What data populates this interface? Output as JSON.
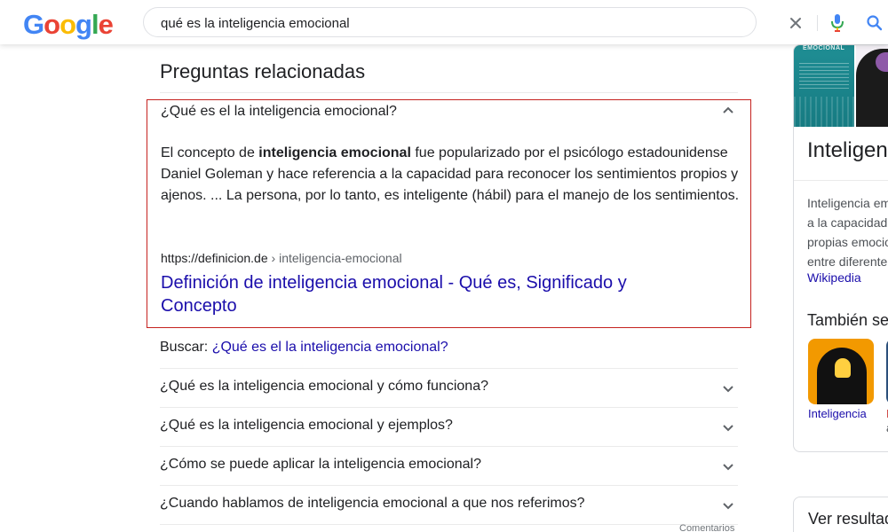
{
  "logo": {
    "letters": [
      "G",
      "o",
      "o",
      "g",
      "l",
      "e"
    ],
    "colors": [
      "#4285F4",
      "#EA4335",
      "#FBBC05",
      "#4285F4",
      "#34A853",
      "#EA4335"
    ]
  },
  "search": {
    "query": "qué es la inteligencia emocional"
  },
  "icons": {
    "clear": "close-icon",
    "mic": "microphone-icon",
    "search": "search-icon",
    "expand": "chevron-down-icon",
    "collapse": "chevron-up-icon"
  },
  "paa": {
    "title": "Preguntas relacionadas",
    "expanded": {
      "question": "¿Qué es el la inteligencia emocional?",
      "answer_prefix": "El concepto de ",
      "answer_bold": "inteligencia emocional",
      "answer_rest": " fue popularizado por el psicólogo estadounidense Daniel Goleman y hace referencia a la capacidad para reconocer los sentimientos propios y ajenos. ... La persona, por lo tanto, es inteligente (hábil) para el manejo de los sentimientos.",
      "source_url": "https://definicion.de",
      "source_crumb": " › inteligencia-emocional",
      "link_title": "Definición de inteligencia emocional - Qué es, Significado y Concepto"
    },
    "buscar_label": "Buscar: ",
    "buscar_link": "¿Qué es el la inteligencia emocional?",
    "questions": [
      "¿Qué es la inteligencia emocional y cómo funciona?",
      "¿Qué es la inteligencia emocional y ejemplos?",
      "¿Cómo se puede aplicar la inteligencia emocional?",
      "¿Cuando hablamos de inteligencia emocional a que nos referimos?"
    ],
    "feedback": "Comentarios"
  },
  "knowledge_panel": {
    "image_label": "EMOCIONAL",
    "title": "Inteligencia emocional",
    "description_lines": [
      "Inteligencia em",
      "a la capacidad",
      "propias emocio",
      "entre diferente"
    ],
    "source": "Wikipedia",
    "also_title": "También se busca",
    "cards": [
      "Inteligencia"
    ],
    "card2_lines": [
      "I",
      "a"
    ],
    "results_title": "Ver resultados"
  },
  "colors": {
    "accent_border": "#c5221f",
    "link": "#1a0dab",
    "mic_blue": "#4285f4",
    "mic_red": "#ea4335"
  }
}
